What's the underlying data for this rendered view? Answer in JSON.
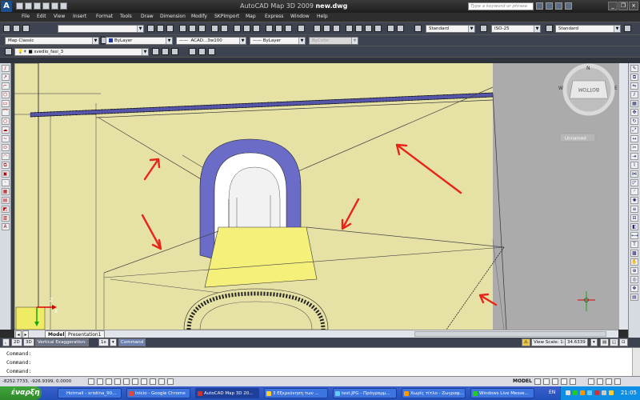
{
  "titlebar": {
    "app_name": "AutoCAD Map 3D 2009",
    "file_name": "new.dwg",
    "search_placeholder": "Type a keyword or phrase"
  },
  "menu": [
    "File",
    "Edit",
    "View",
    "Insert",
    "Format",
    "Tools",
    "Draw",
    "Dimension",
    "Modify",
    "SKPImport",
    "Map",
    "Express",
    "Window",
    "Help"
  ],
  "toolbar": {
    "text_style": "Standard",
    "dim_style": "ISO-25",
    "table_style": "Standard",
    "workspace": "Map Classic",
    "color": "ByLayer",
    "linetype": "ACAD...3w100",
    "lineweight": "ByLayer",
    "plot_style": "ByColor",
    "layer": "svedio_fasi_3"
  },
  "viewcube": {
    "face_label": "BOTTOM",
    "view_name": "Unnamed"
  },
  "ucs": {
    "z": "Z",
    "x": "X",
    "y": "Y"
  },
  "layout_tabs": [
    "Model",
    "Presentation1"
  ],
  "status_row": {
    "btn_2d": "2D",
    "btn_3d": "3D",
    "vert_exag_label": "Vertical Exaggeration:",
    "vert_exag_value": "1x",
    "command_label": "Command",
    "view_scale_label": "View Scale: 1:",
    "view_scale_value": "34.6339"
  },
  "command_window": [
    "Command:",
    "Command:",
    "Command:"
  ],
  "statusbar": {
    "coords": "-8252.7733, -926.9399, 0.0000",
    "model": "MODEL"
  },
  "taskbar": {
    "start_label": "έναρξη",
    "tasks": [
      "Hotmail - xristina_90...",
      "Inicio - Google Chrome",
      "AutoCAD Map 3D 20...",
      "3 Εξερεύνηση των ...",
      "test.JPG - Πρόγραμμ...",
      "Χωρίς τίτλο - Ζωγραφ...",
      "Windows Live Messe..."
    ],
    "language": "EN",
    "clock": "21:05"
  },
  "annotation_color": "#e8251a",
  "drawing_fill": "#e6e2a6"
}
